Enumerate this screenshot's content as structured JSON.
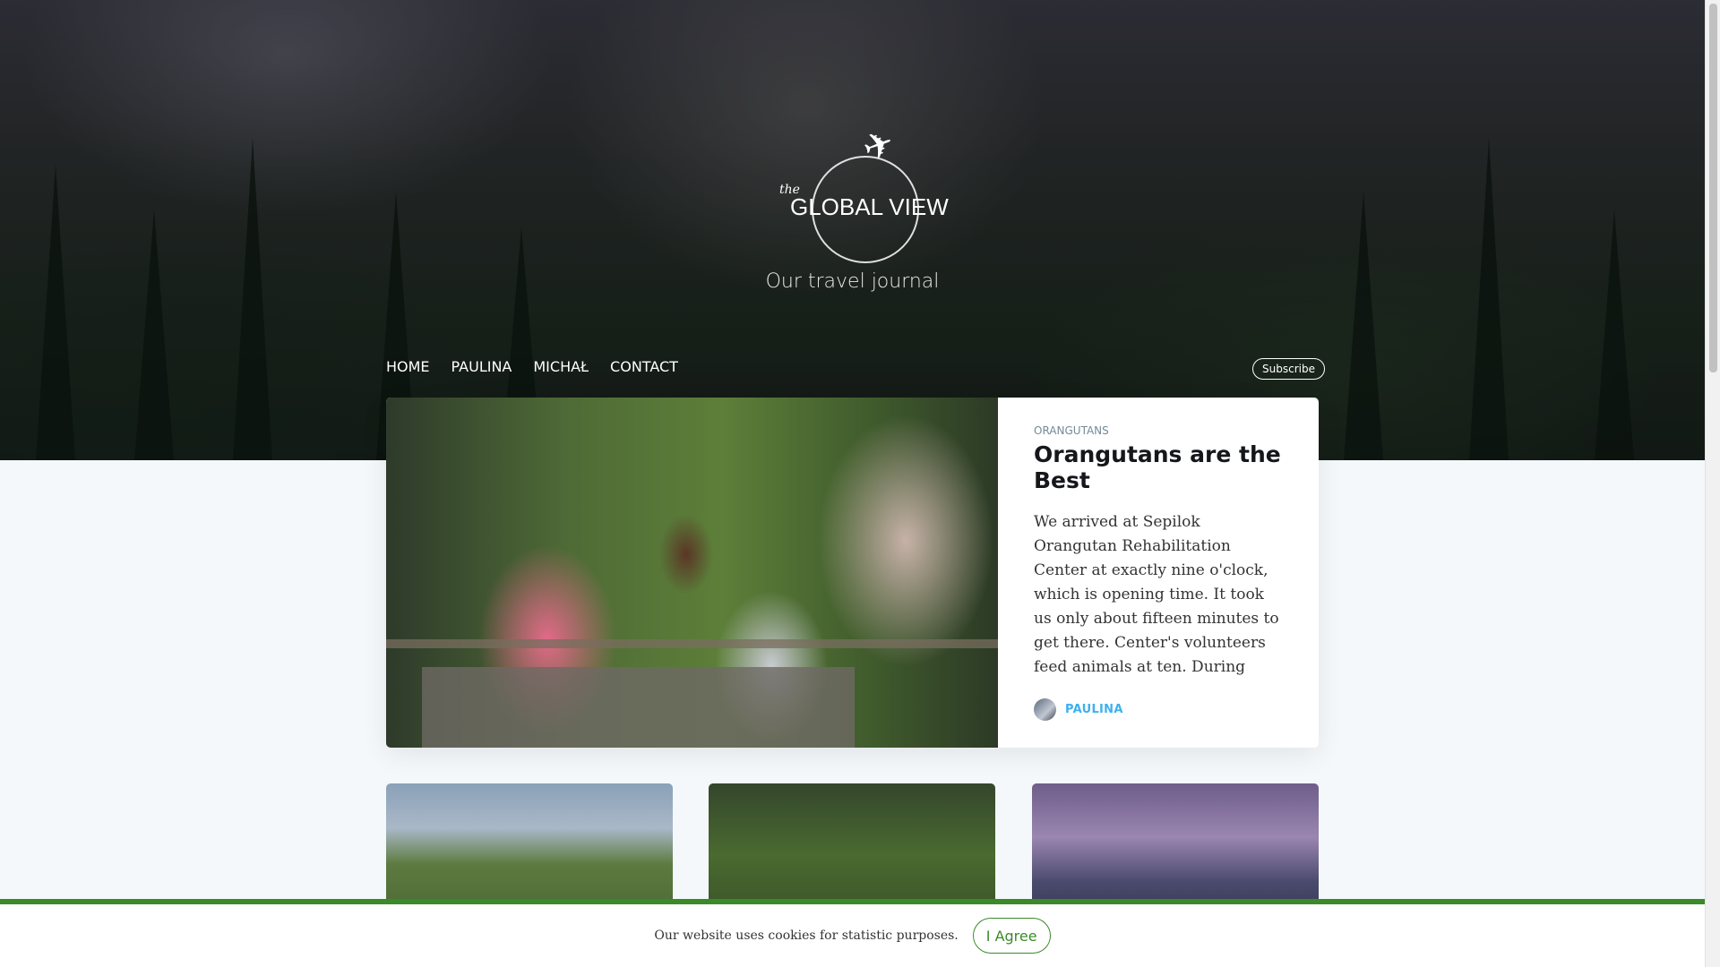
{
  "site": {
    "logo_the": "the",
    "logo_name": "GLOBAL VIEW",
    "tagline": "Our travel journal"
  },
  "nav": {
    "items": [
      "HOME",
      "PAULINA",
      "MICHAŁ",
      "CONTACT"
    ],
    "subscribe_label": "Subscribe"
  },
  "featured": {
    "tag": "ORANGUTANS",
    "title": "Orangutans are the Best",
    "excerpt": "We arrived at Sepilok Orangutan Rehabilitation Center at exactly nine o'clock, which is opening time. It took us only about fifteen minutes to get there. Center's volunteers feed animals at ten. During",
    "author": "PAULINA"
  },
  "cookie": {
    "text": "Our website uses cookies for statistic purposes.",
    "button_label": "I Agree"
  },
  "colors": {
    "accent": "#3eb0ef",
    "cookie_green": "#3b8a2a"
  }
}
